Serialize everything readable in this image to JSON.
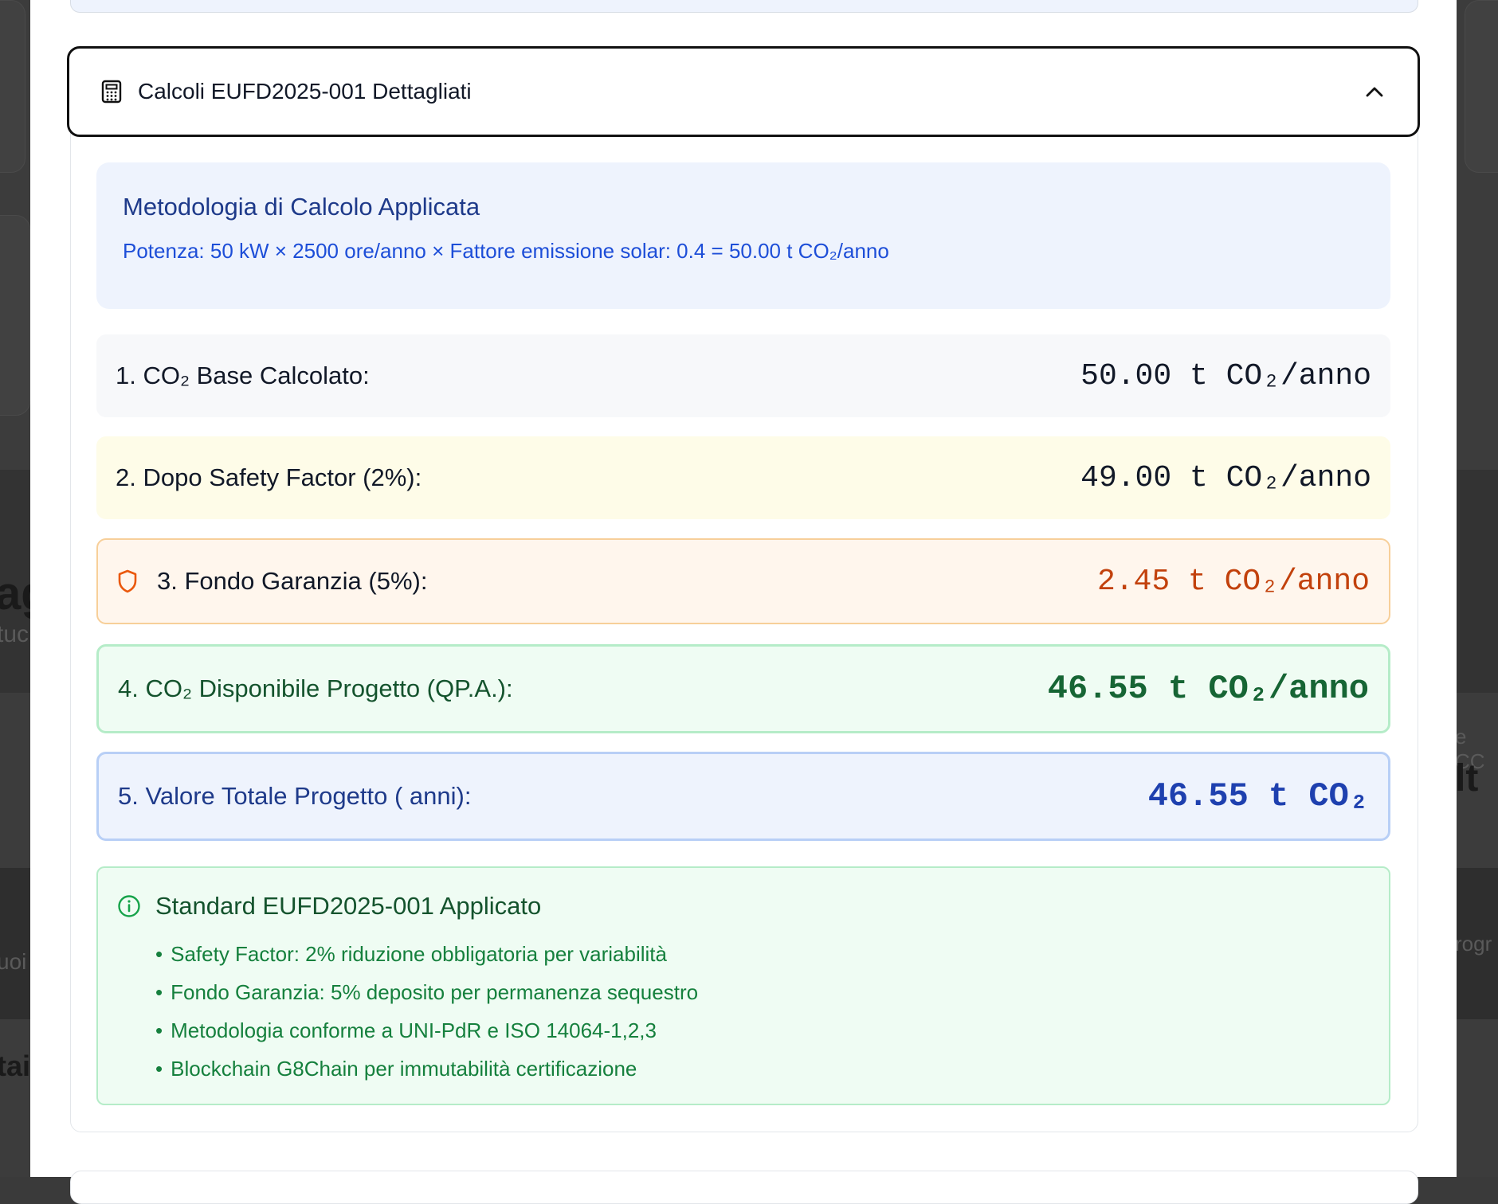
{
  "background": {
    "left_text_1": "ag",
    "left_sub_1": "tuc",
    "left_text_2": "uoi",
    "left_text_3": "taic",
    "right_text_1": "e CC",
    "right_text_2": "lt",
    "right_text_3": "rogr"
  },
  "accordion": {
    "icon": "calculator-icon",
    "title": "Calcoli EUFD2025-001 Dettagliati",
    "chevron": "chevron-up-icon"
  },
  "methodology": {
    "title": "Metodologia di Calcolo Applicata",
    "formula": "Potenza: 50 kW × 2500 ore/anno × Fattore emissione solar: 0.4 = 50.00 t CO₂/anno"
  },
  "rows": [
    {
      "label": "1. CO₂ Base Calcolato:",
      "value": "50.00 t CO₂/anno"
    },
    {
      "label": "2. Dopo Safety Factor (2%):",
      "value": "49.00 t CO₂/anno"
    },
    {
      "label": "3. Fondo Garanzia (5%):",
      "value": "2.45 t CO₂/anno",
      "icon": "shield-icon"
    },
    {
      "label": "4. CO₂ Disponibile Progetto (QP.A.):",
      "value": "46.55 t CO₂/anno"
    },
    {
      "label": "5. Valore Totale Progetto ( anni):",
      "value": "46.55 t CO₂"
    }
  ],
  "standard": {
    "icon": "info-icon",
    "title": "Standard EUFD2025-001 Applicato",
    "items": [
      "Safety Factor: 2% riduzione obbligatoria per variabilità",
      "Fondo Garanzia: 5% deposito per permanenza sequestro",
      "Metodologia conforme a UNI-PdR e ISO 14064-1,2,3",
      "Blockchain G8Chain per immutabilità certificazione"
    ]
  },
  "colors": {
    "accent_blue": "#1e40af",
    "accent_green": "#166534",
    "accent_orange": "#c2410c"
  }
}
